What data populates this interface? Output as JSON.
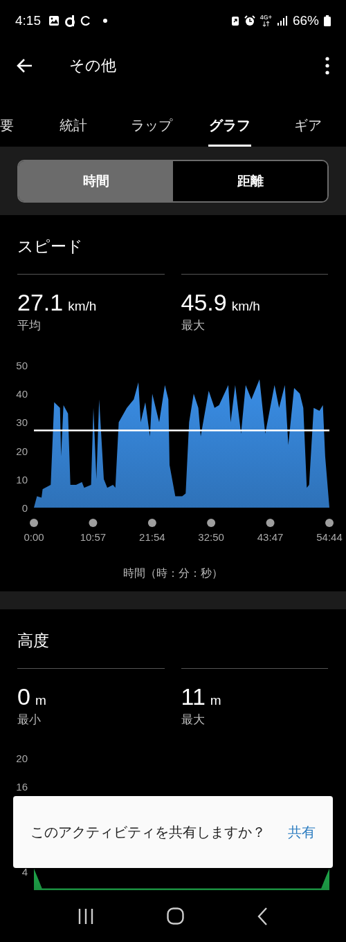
{
  "status_bar": {
    "time": "4:15",
    "network": "4G+",
    "battery": "66%"
  },
  "app_bar": {
    "title": "その他"
  },
  "tabs": [
    {
      "label": "要",
      "selected": false
    },
    {
      "label": "統計",
      "selected": false
    },
    {
      "label": "ラップ",
      "selected": false
    },
    {
      "label": "グラフ",
      "selected": true
    },
    {
      "label": "ギア",
      "selected": false
    }
  ],
  "segments": [
    {
      "label": "時間",
      "selected": true
    },
    {
      "label": "距離",
      "selected": false
    }
  ],
  "sections": [
    {
      "title": "スピード",
      "stats": [
        {
          "value": "27.1",
          "unit": "km/h",
          "label": "平均"
        },
        {
          "value": "45.9",
          "unit": "km/h",
          "label": "最大"
        }
      ],
      "chart_data": {
        "type": "area",
        "xlabel": "時間（時：分：秒）",
        "xlim": [
          0,
          54.73
        ],
        "ylim": [
          0,
          50
        ],
        "yticks": [
          0,
          10,
          20,
          30,
          40,
          50
        ],
        "xticks": [
          {
            "value": 0,
            "label": "0:00"
          },
          {
            "value": 10.95,
            "label": "10:57"
          },
          {
            "value": 21.9,
            "label": "21:54"
          },
          {
            "value": 32.83,
            "label": "32:50"
          },
          {
            "value": 43.78,
            "label": "43:47"
          },
          {
            "value": 54.73,
            "label": "54:44"
          }
        ],
        "x": [
          0,
          0.56,
          1.41,
          1.62,
          3.12,
          3.76,
          4.83,
          5.04,
          5.47,
          6.32,
          6.75,
          7.82,
          8.89,
          9.31,
          10.59,
          11.02,
          11.58,
          12.09,
          12.94,
          13.58,
          14.65,
          15.08,
          15.72,
          17.22,
          18.5,
          19.35,
          19.78,
          20.63,
          21.49,
          21.92,
          23.2,
          24.26,
          24.91,
          25.12,
          26.19,
          27.47,
          28.11,
          28.75,
          29.6,
          30.46,
          30.89,
          32.38,
          33.45,
          34.3,
          36.01,
          36.44,
          37.29,
          38.36,
          39.22,
          40.28,
          41.78,
          42.85,
          44.56,
          45.41,
          46.48,
          47.12,
          48.19,
          49.26,
          49.9,
          50.54,
          50.97,
          51.82,
          52.89,
          53.53,
          53.95,
          54.73
        ],
        "series": [
          {
            "color": "#3a8ee6",
            "values": [
              0,
              4,
              3.5,
              6.5,
              8,
              37,
              35,
              18,
              36,
              33,
              8,
              8,
              9,
              7,
              8,
              35,
              10,
              38,
              10,
              7,
              8,
              7,
              30,
              35,
              38,
              44,
              30,
              37,
              25,
              40,
              30,
              43,
              38,
              15,
              4,
              4,
              5,
              30,
              40,
              35,
              25,
              41,
              35,
              36,
              43,
              30,
              43,
              26,
              43,
              38,
              45,
              26,
              43,
              35,
              43,
              22,
              42,
              40,
              35,
              7,
              8,
              35,
              34,
              36,
              18,
              0
            ]
          }
        ],
        "ref_lines": [
          {
            "axis": "y",
            "value": 27.1,
            "color": "#ffffff"
          }
        ]
      }
    },
    {
      "title": "高度",
      "stats": [
        {
          "value": "0",
          "unit": "m",
          "label": "最小"
        },
        {
          "value": "11",
          "unit": "m",
          "label": "最大"
        }
      ],
      "chart_data": {
        "type": "area",
        "xlim": [
          0,
          54.73
        ],
        "ylim": [
          0,
          20
        ],
        "yticks": [
          4,
          16,
          20
        ],
        "x": [
          0,
          0.6,
          1.5,
          53.2,
          54.1,
          54.73
        ],
        "series": [
          {
            "color": "#1fa64a",
            "values": [
              4.4,
              3.3,
              1.6,
              1.6,
              3.3,
              4.4
            ]
          }
        ]
      }
    }
  ],
  "snackbar": {
    "message": "このアクティビティを共有しますか？",
    "action": "共有"
  }
}
